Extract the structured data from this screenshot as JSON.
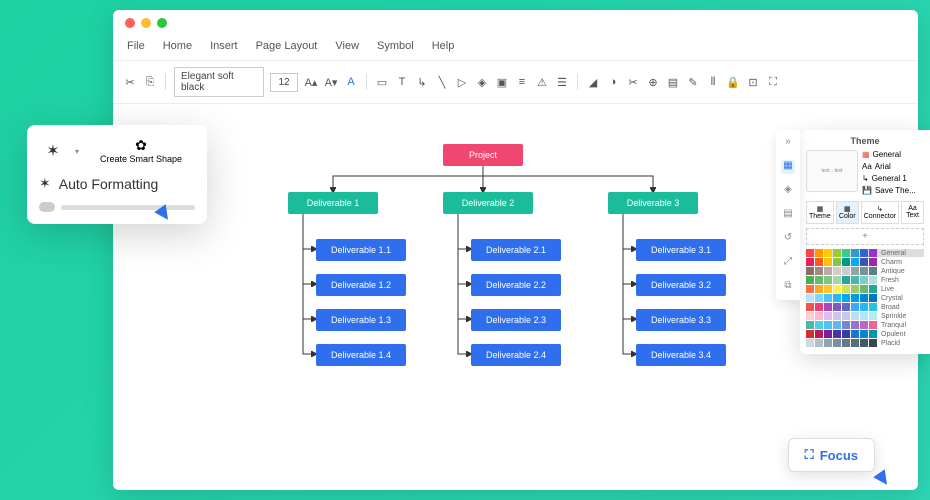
{
  "menu": {
    "file": "File",
    "home": "Home",
    "insert": "Insert",
    "pageLayout": "Page Layout",
    "view": "View",
    "symbol": "Symbol",
    "help": "Help"
  },
  "toolbar": {
    "font": "Elegant soft black",
    "size": "12"
  },
  "popup": {
    "createSmart": "Create Smart Shape",
    "autoFormat": "Auto Formatting"
  },
  "org": {
    "root": "Project",
    "d1": {
      "label": "Deliverable 1",
      "subs": [
        "Deliverable 1.1",
        "Deliverable 1.2",
        "Deliverable 1.3",
        "Deliverable 1.4"
      ]
    },
    "d2": {
      "label": "Deliverable 2",
      "subs": [
        "Deliverable 2.1",
        "Deliverable 2.2",
        "Deliverable 2.3",
        "Deliverable 2.4"
      ]
    },
    "d3": {
      "label": "Deliverable 3",
      "subs": [
        "Deliverable 3.1",
        "Deliverable 3.2",
        "Deliverable 3.3",
        "Deliverable 3.4"
      ]
    }
  },
  "theme": {
    "title": "Theme",
    "general": "General",
    "arial": "Arial",
    "general1": "General 1",
    "saveThe": "Save The...",
    "tabs": {
      "theme": "Theme",
      "color": "Color",
      "connector": "Connector",
      "text": "Text"
    },
    "add": "+",
    "palettes": [
      "General",
      "Charm",
      "Antique",
      "Fresh",
      "Live",
      "Crystal",
      "Broad",
      "Sprinkle",
      "Tranquil",
      "Opulent",
      "Placid"
    ]
  },
  "focus": "Focus"
}
